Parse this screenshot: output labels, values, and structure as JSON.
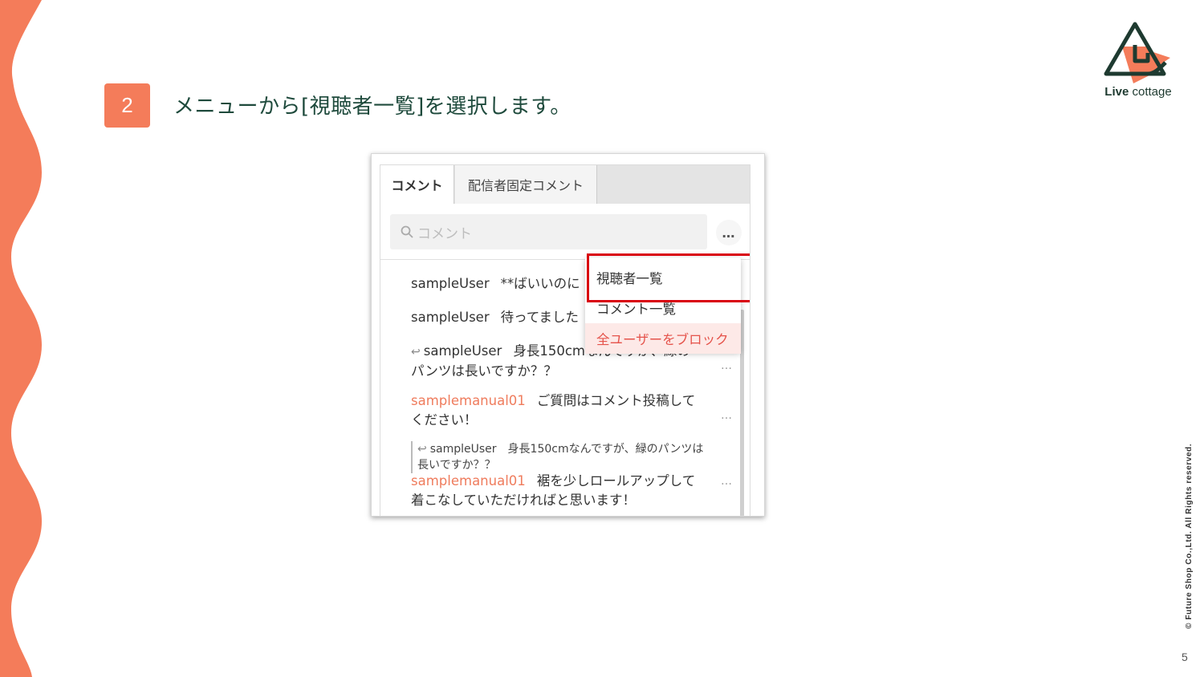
{
  "slide": {
    "step_number": "2",
    "instruction": "メニューから[視聴者一覧]を選択します。",
    "logo_bold": "Live",
    "logo_light": " cottage",
    "copyright": "© Future Shop Co.,Ltd. All Rights reserved.",
    "page_number": "5",
    "accent_color": "#f47c5a",
    "text_color": "#1e4a3c"
  },
  "screenshot": {
    "tabs": {
      "active": "コメント",
      "other": "配信者固定コメント"
    },
    "search": {
      "placeholder": "コメント",
      "icon": "search-icon"
    },
    "more_button": "…",
    "menu": {
      "items": [
        "視聴者一覧",
        "コメント一覧",
        "全ユーザーをブロック"
      ],
      "highlighted": "視聴者一覧"
    },
    "comments": [
      {
        "user": "sampleUser",
        "text": "**ばいいのに"
      },
      {
        "user": "sampleUser",
        "text": "待ってました"
      },
      {
        "user": "sampleUser",
        "text": "身長150cmなんですが、緑のパンツは長いですか？？",
        "reply": true
      },
      {
        "user": "samplemanual01",
        "text": "ご質問はコメント投稿してください！",
        "staff": true
      },
      {
        "quote_user": "sampleUser",
        "quote_text": "身長150cmなんですが、緑のパンツは長いですか？？",
        "user": "samplemanual01",
        "text": "裾を少しロールアップして着こなしていただければと思います！",
        "staff": true
      }
    ],
    "comment_more": "…"
  }
}
